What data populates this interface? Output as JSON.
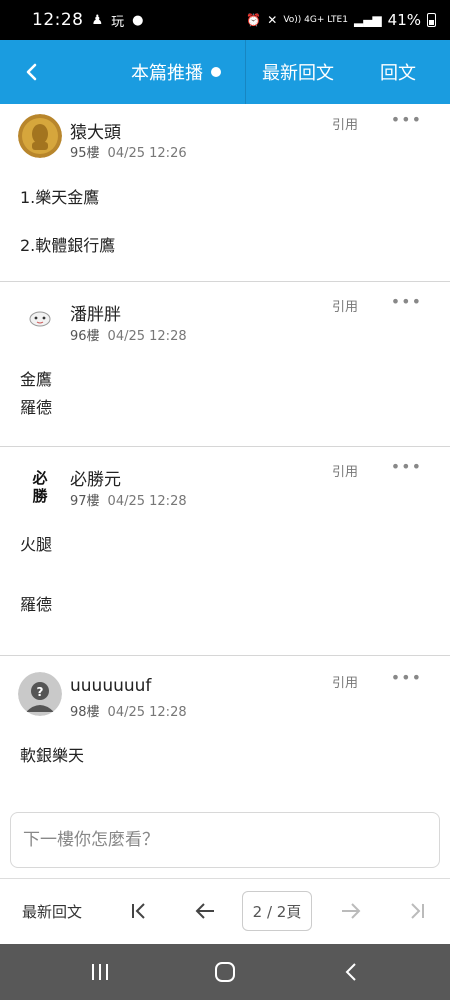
{
  "status_bar": {
    "time": "12:28",
    "network": "Vo)) 4G+ LTE1",
    "battery": "41%"
  },
  "header": {
    "tab_push": "本篇推播",
    "tab_latest": "最新回文",
    "tab_reply": "回文"
  },
  "posts": [
    {
      "username": "猿大頭",
      "floor": "95樓",
      "time": "04/25 12:26",
      "quote": "引用",
      "more": "•••",
      "lines": [
        "1.樂天金鷹",
        "2.軟體銀行鷹"
      ]
    },
    {
      "username": "潘胖胖",
      "floor": "96樓",
      "time": "04/25 12:28",
      "quote": "引用",
      "more": "•••",
      "lines": [
        "金鷹",
        "羅德"
      ]
    },
    {
      "username": "必勝元",
      "floor": "97樓",
      "time": "04/25 12:28",
      "quote": "引用",
      "more": "•••",
      "lines": [
        "火腿",
        "羅德"
      ]
    },
    {
      "username": "uuuuuuuf",
      "floor": "98樓",
      "time": "04/25 12:28",
      "quote": "引用",
      "more": "•••",
      "lines": [
        "軟銀樂天"
      ]
    }
  ],
  "reply_input": {
    "placeholder": "下一樓你怎麼看？"
  },
  "bottom_nav": {
    "latest_label": "最新回文",
    "page_indicator": "2 / 2頁"
  },
  "colors": {
    "accent": "#1a9ce0",
    "android_nav": "#585858"
  }
}
